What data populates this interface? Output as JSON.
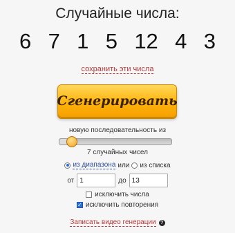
{
  "title": "Случайные числа:",
  "numbers": [
    "6",
    "7",
    "1",
    "5",
    "12",
    "4",
    "3"
  ],
  "save_link": "сохранить эти числа",
  "generate_button": "Сгенерировать",
  "sequence_label": "новую последовательность из",
  "slider": {
    "value_fraction": 0.1
  },
  "count_label": "7 случайных чисел",
  "source": {
    "option_range": "из диапазона",
    "or_text": "или",
    "option_list": "из списка",
    "selected": "range"
  },
  "range": {
    "from_label": "от",
    "from_value": "1",
    "to_label": "до",
    "to_value": "13"
  },
  "exclude_numbers": {
    "label": "исключить числа",
    "checked": false
  },
  "exclude_repeats": {
    "label": "исключить повторения",
    "checked": true
  },
  "record_link": "Записать видео генерации",
  "help_icon": "?"
}
